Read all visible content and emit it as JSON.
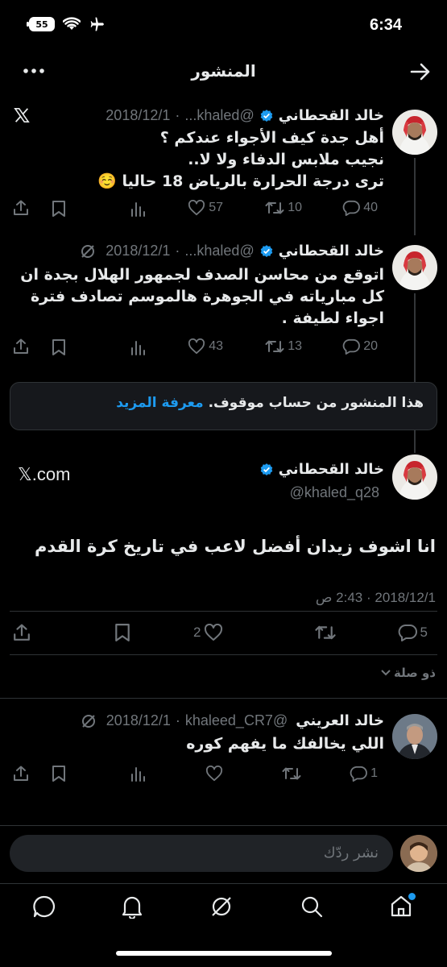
{
  "status": {
    "time": "6:34",
    "battery": "55"
  },
  "header": {
    "title": "المنشور"
  },
  "tweets": [
    {
      "name": "خالد القحطاني",
      "handle": "@khaled...",
      "date": "2018/12/1",
      "text_lines": [
        "أهل جدة كيف الأجواء عندكم ؟",
        "نجيب ملابس الدفاء ولا لا..",
        "ترى درجة الحرارة بالرياض 18 حاليا ☺️"
      ],
      "replies": "40",
      "retweets": "10",
      "likes": "57"
    },
    {
      "name": "خالد القحطاني",
      "handle": "@khaled...",
      "date": "2018/12/1",
      "text_lines": [
        "اتوقع من محاسن الصدف لجمهور الهلال بجدة ان",
        "كل مبارياته في الجوهرة هالموسم تصادف فترة",
        "اجواء لطيفة ."
      ],
      "replies": "20",
      "retweets": "13",
      "likes": "43"
    }
  ],
  "notice": {
    "text": "هذا المنشور من حساب موقوف.",
    "link": "معرفة المزيد"
  },
  "main_tweet": {
    "name": "خالد القحطاني",
    "handle": "@khaled_q28",
    "source": "𝕏.com",
    "text": "انا اشوف زيدان أفضل لاعب في تاريخ كرة القدم",
    "timestamp": "2018/12/1 · 2:43 ص",
    "replies": "5",
    "likes": "2"
  },
  "related": {
    "label": "ذو صلة"
  },
  "reply_tweet": {
    "name": "خالد العريني",
    "handle": "@khaleed_CR7",
    "date": "2018/12/1",
    "text": "اللي يخالفك ما يفهم كوره",
    "replies": "1"
  },
  "composer": {
    "placeholder": "نشر ردّك"
  },
  "colors": {
    "accent": "#1d9bf0",
    "verified": "#1d9bf0",
    "background": "#000000",
    "muted": "#71767b"
  }
}
